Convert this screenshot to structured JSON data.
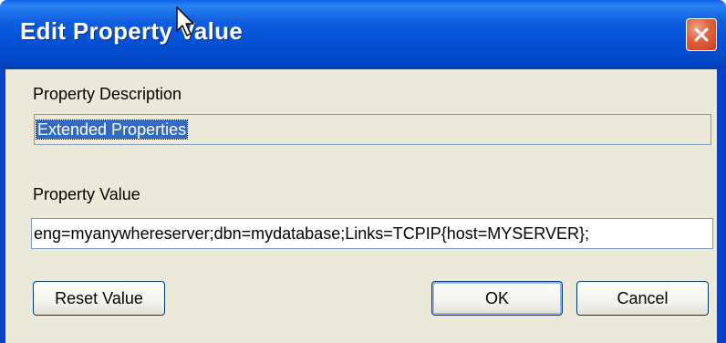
{
  "window": {
    "title": "Edit Property Value",
    "close_icon": "close-icon"
  },
  "description": {
    "label": "Property Description",
    "value": "Extended Properties"
  },
  "property_value": {
    "label": "Property Value",
    "value": "eng=myanywhereserver;dbn=mydatabase;Links=TCPIP{host=MYSERVER};"
  },
  "buttons": {
    "reset": "Reset Value",
    "ok": "OK",
    "cancel": "Cancel"
  },
  "colors": {
    "titlebar": "#0550d6",
    "client": "#ece9d8",
    "selection": "#316ac5",
    "close": "#e0613a"
  }
}
